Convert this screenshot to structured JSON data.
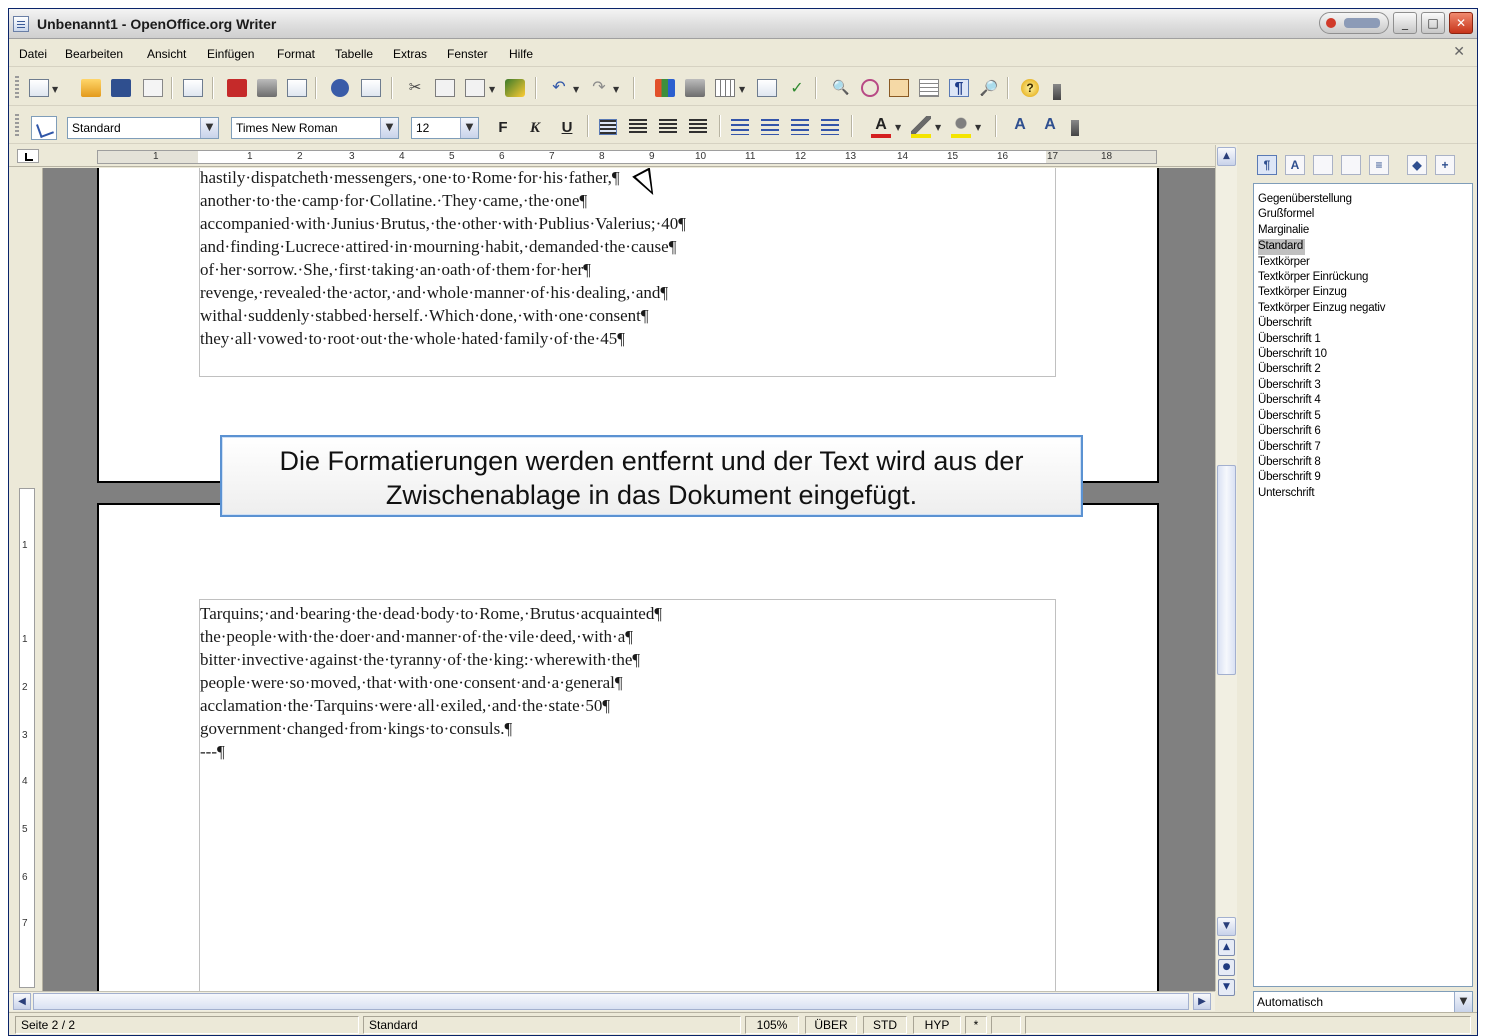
{
  "window": {
    "title": "Unbenannt1 - OpenOffice.org Writer",
    "minimize_glyph": "_",
    "maximize_glyph": "□",
    "close_glyph": "✕"
  },
  "menubar": {
    "items": [
      "Datei",
      "Bearbeiten",
      "Ansicht",
      "Einfügen",
      "Format",
      "Tabelle",
      "Extras",
      "Fenster",
      "Hilfe"
    ],
    "close_doc_glyph": "✕"
  },
  "toolbar_standard": {
    "cut_glyph": "✂",
    "undo_glyph": "↶",
    "redo_glyph": "↷",
    "check_glyph": "✓",
    "find_glyph": "🔍",
    "pilcrow_glyph": "¶",
    "zoom_glyph": "🔎",
    "help_glyph": "?"
  },
  "toolbar_format": {
    "paragraph_style": "Standard",
    "font_name": "Times New Roman",
    "font_size": "12",
    "bold_label": "F",
    "italic_label": "K",
    "underline_label": "U",
    "font_color_label": "A",
    "char_format_label": "A"
  },
  "ruler_horizontal": {
    "numbers": [
      "1",
      "1",
      "2",
      "3",
      "4",
      "5",
      "6",
      "7",
      "8",
      "9",
      "10",
      "11",
      "12",
      "13",
      "14",
      "15",
      "16",
      "17",
      "18"
    ]
  },
  "ruler_vertical": {
    "numbers": [
      "1",
      "1",
      "2",
      "3",
      "4",
      "5",
      "6",
      "7"
    ]
  },
  "document": {
    "page1_lines": [
      "hastily·dispatcheth·messengers,·one·to·Rome·for·his·father,¶",
      "another·to·the·camp·for·Collatine.·They·came,·the·one¶",
      "accompanied·with·Junius·Brutus,·the·other·with·Publius·Valerius;·40¶",
      "and·finding·Lucrece·attired·in·mourning·habit,·demanded·the·cause¶",
      "of·her·sorrow.·She,·first·taking·an·oath·of·them·for·her¶",
      "revenge,·revealed·the·actor,·and·whole·manner·of·his·dealing,·and¶",
      "withal·suddenly·stabbed·herself.·Which·done,·with·one·consent¶",
      "they·all·vowed·to·root·out·the·whole·hated·family·of·the·45¶"
    ],
    "page2_lines": [
      "Tarquins;·and·bearing·the·dead·body·to·Rome,·Brutus·acquainted¶",
      "the·people·with·the·doer·and·manner·of·the·vile·deed,·with·a¶",
      "bitter·invective·against·the·tyranny·of·the·king:·wherewith·the¶",
      "people·were·so·moved,·that·with·one·consent·and·a·general¶",
      "acclamation·the·Tarquins·were·all·exiled,·and·the·state·50¶",
      "government·changed·from·kings·to·consuls.¶",
      "---¶"
    ]
  },
  "callout": {
    "line1": "Die Formatierungen werden entfernt und der Text wird aus der",
    "line2": "Zwischenablage in das Dokument eingefügt."
  },
  "stylist": {
    "styles": [
      "Gegenüberstellung",
      "Grußformel",
      "Marginalie",
      "Standard",
      "Textkörper",
      "Textkörper Einrückung",
      "Textkörper Einzug",
      "Textkörper Einzug negativ",
      "Überschrift",
      "Überschrift 1",
      "Überschrift 10",
      "Überschrift 2",
      "Überschrift 3",
      "Überschrift 4",
      "Überschrift 5",
      "Überschrift 6",
      "Überschrift 7",
      "Überschrift 8",
      "Überschrift 9",
      "Unterschrift"
    ],
    "selected_style": "Standard",
    "filter": "Automatisch"
  },
  "statusbar": {
    "page": "Seite 2 / 2",
    "page_style": "Standard",
    "zoom": "105%",
    "insert_mode": "ÜBER",
    "selection_mode": "STD",
    "hyperlink_mode": "HYP",
    "modified": "*"
  },
  "colors": {
    "callout_border": "#5b92d2",
    "workspace": "#808080",
    "selected_style_bg": "#c0c0c0"
  }
}
